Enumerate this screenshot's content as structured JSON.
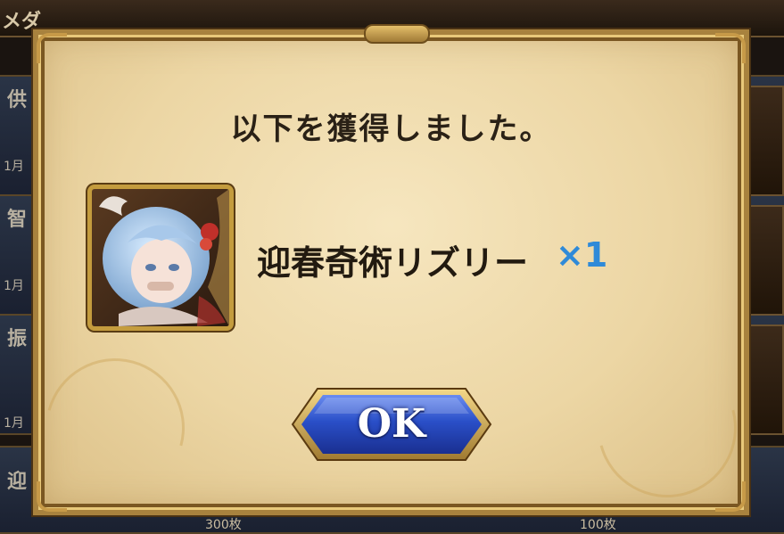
{
  "background": {
    "header_label": "メダ",
    "rows": [
      {
        "label": "供",
        "sub": "1月"
      },
      {
        "label": "智",
        "sub": "1月"
      },
      {
        "label": "振",
        "sub": "1月"
      },
      {
        "label": "迎",
        "sub": ""
      }
    ],
    "bottom_left": "300枚",
    "bottom_right": "100枚"
  },
  "dialog": {
    "message": "以下を獲得しました。",
    "reward": {
      "name": "迎春奇術リズリー",
      "quantity": "×1",
      "icon": "character-portrait-icon"
    },
    "ok_label": "OK"
  },
  "colors": {
    "quantity": "#2f8ad8",
    "ok_button": "#2a4fc8",
    "parchment": "#f0dcac",
    "frame": "#a8823e"
  }
}
